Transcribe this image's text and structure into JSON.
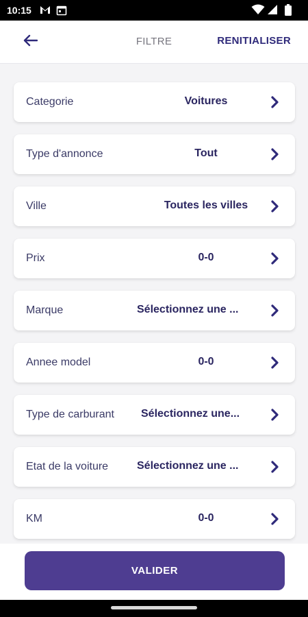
{
  "status_bar": {
    "time": "10:15",
    "icons": [
      "gmail-icon",
      "calendar-icon",
      "wifi-icon",
      "signal-icon",
      "battery-icon"
    ]
  },
  "header": {
    "title": "FILTRE",
    "reset_label": "RENITIALISER",
    "back_icon": "arrow-left-icon"
  },
  "filters": [
    {
      "label": "Categorie",
      "value": "Voitures"
    },
    {
      "label": "Type d'annonce",
      "value": "Tout"
    },
    {
      "label": "Ville",
      "value": "Toutes les villes"
    },
    {
      "label": "Prix",
      "value": "0-0"
    },
    {
      "label": "Marque",
      "value": "Sélectionnez une ..."
    },
    {
      "label": "Annee model",
      "value": "0-0"
    },
    {
      "label": "Type de carburant",
      "value": "Sélectionnez une..."
    },
    {
      "label": "Etat de la voiture",
      "value": "Sélectionnez une ..."
    },
    {
      "label": "KM",
      "value": "0-0"
    }
  ],
  "submit_label": "VALIDER",
  "colors": {
    "accent": "#2f2a7a",
    "button": "#4e3d91",
    "background": "#f4f4f6"
  }
}
